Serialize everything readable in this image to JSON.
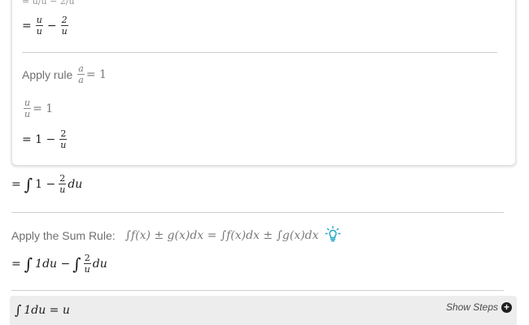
{
  "card": {
    "top_line": "= u/u − 2/u",
    "line1": {
      "eq": "=",
      "num1": "u",
      "den1": "u",
      "op": "−",
      "num2": "2",
      "den2": "u"
    },
    "apply_rule": {
      "label": "Apply rule",
      "num": "a",
      "den": "a",
      "rest": "= 1"
    },
    "line2": {
      "num": "u",
      "den": "u",
      "rest": "= 1"
    },
    "line3": {
      "prefix": "= 1 −",
      "num": "2",
      "den": "u"
    }
  },
  "line_integral": {
    "prefix": "=",
    "int": "∫",
    "body": "1 −",
    "num": "2",
    "den": "u",
    "tail": "du"
  },
  "sum_rule": {
    "label": "Apply the Sum Rule:",
    "formula": "∫f(x) ± g(x)dx = ∫f(x)dx ± ∫g(x)dx"
  },
  "line_split": {
    "prefix": "=",
    "int1": "∫",
    "part1": "1du −",
    "int2": "∫",
    "num": "2",
    "den": "u",
    "tail": "du"
  },
  "step_bar": {
    "expr_int": "∫",
    "expr": "1du = u",
    "show_steps": "Show Steps",
    "plus": "+"
  },
  "colors": {
    "bulb": "#19a6c4",
    "divider": "#cfcfcf",
    "step_bar": "#ededed"
  }
}
